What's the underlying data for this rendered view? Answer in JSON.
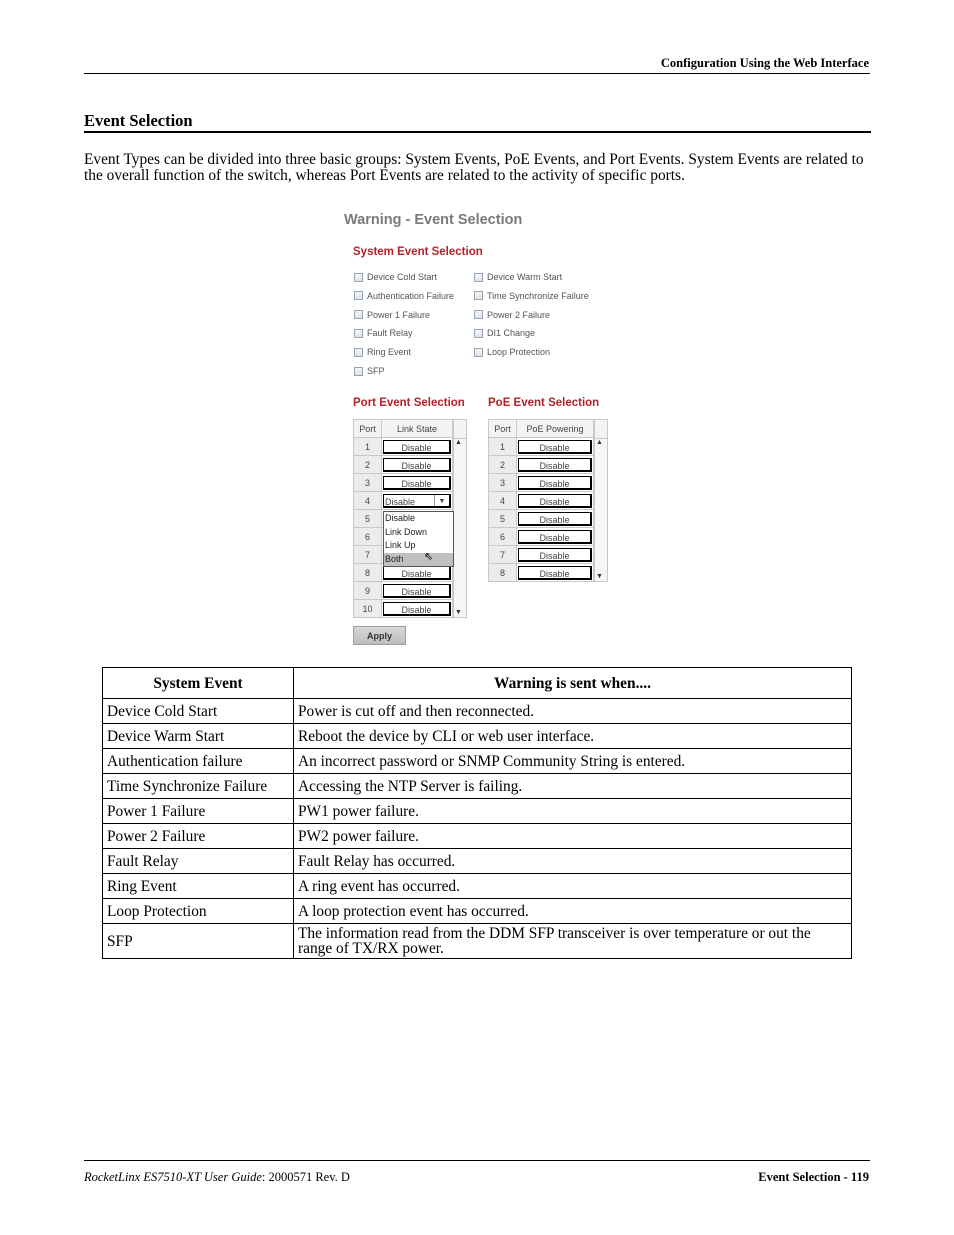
{
  "header": {
    "running_head": "Configuration Using the Web Interface"
  },
  "section": {
    "title": "Event Selection",
    "intro": "Event Types can be divided into three basic groups: System Events, PoE Events, and Port Events. System Events are related to the overall function of the switch, whereas Port Events are related to the activity of specific ports."
  },
  "ui": {
    "title": "Warning - Event Selection",
    "accent_color": "#b0232a",
    "system_heading": "System Event Selection",
    "system_checkboxes": [
      {
        "label": "Device Cold Start",
        "checked": false
      },
      {
        "label": "Device Warm Start",
        "checked": false
      },
      {
        "label": "Authentication Failure",
        "checked": false
      },
      {
        "label": "Time Synchronize Failure",
        "checked": false
      },
      {
        "label": "Power 1 Failure",
        "checked": false
      },
      {
        "label": "Power 2 Failure",
        "checked": false
      },
      {
        "label": "Fault Relay",
        "checked": false
      },
      {
        "label": "DI1 Change",
        "checked": false
      },
      {
        "label": "Ring Event",
        "checked": false
      },
      {
        "label": "Loop Protection",
        "checked": false
      },
      {
        "label": "SFP",
        "checked": false
      }
    ],
    "port_heading": "Port Event Selection",
    "port_table": {
      "col_port": "Port",
      "col_value": "Link State",
      "rows": [
        {
          "port": "1",
          "value": "Disable"
        },
        {
          "port": "2",
          "value": "Disable"
        },
        {
          "port": "3",
          "value": "Disable"
        },
        {
          "port": "4",
          "value": "Disable"
        },
        {
          "port": "5",
          "value": ""
        },
        {
          "port": "6",
          "value": ""
        },
        {
          "port": "7",
          "value": ""
        },
        {
          "port": "8",
          "value": "Disable"
        },
        {
          "port": "9",
          "value": "Disable"
        },
        {
          "port": "10",
          "value": "Disable"
        }
      ],
      "open_dropdown": {
        "port": "4",
        "options": [
          "Disable",
          "Link Down",
          "Link Up",
          "Both"
        ],
        "highlighted": "Both"
      }
    },
    "poe_heading": "PoE Event Selection",
    "poe_table": {
      "col_port": "Port",
      "col_value": "PoE Powering",
      "rows": [
        {
          "port": "1",
          "value": "Disable"
        },
        {
          "port": "2",
          "value": "Disable"
        },
        {
          "port": "3",
          "value": "Disable"
        },
        {
          "port": "4",
          "value": "Disable"
        },
        {
          "port": "5",
          "value": "Disable"
        },
        {
          "port": "6",
          "value": "Disable"
        },
        {
          "port": "7",
          "value": "Disable"
        },
        {
          "port": "8",
          "value": "Disable"
        }
      ]
    },
    "apply_label": "Apply"
  },
  "events_table": {
    "headers": [
      "System Event",
      "Warning is sent when...."
    ],
    "rows": [
      [
        "Device Cold Start",
        "Power is cut off and then reconnected."
      ],
      [
        "Device Warm Start",
        "Reboot the device by CLI or web user interface."
      ],
      [
        "Authentication failure",
        "An incorrect password or SNMP Community String is entered."
      ],
      [
        "Time Synchronize Failure",
        "Accessing the NTP Server is failing."
      ],
      [
        "Power 1 Failure",
        "PW1 power failure."
      ],
      [
        "Power 2 Failure",
        "PW2 power failure."
      ],
      [
        "Fault Relay",
        "Fault Relay has occurred."
      ],
      [
        "Ring Event",
        "A ring event has occurred."
      ],
      [
        "Loop Protection",
        "A loop protection event has occurred."
      ],
      [
        "SFP",
        "The information read from the DDM SFP transceiver is over temperature or out the range of TX/RX power."
      ]
    ]
  },
  "footer": {
    "left_italic": "RocketLinx ES7510-XT  User Guide",
    "left_rest": ": 2000571 Rev. D",
    "right": "Event Selection - 119"
  }
}
